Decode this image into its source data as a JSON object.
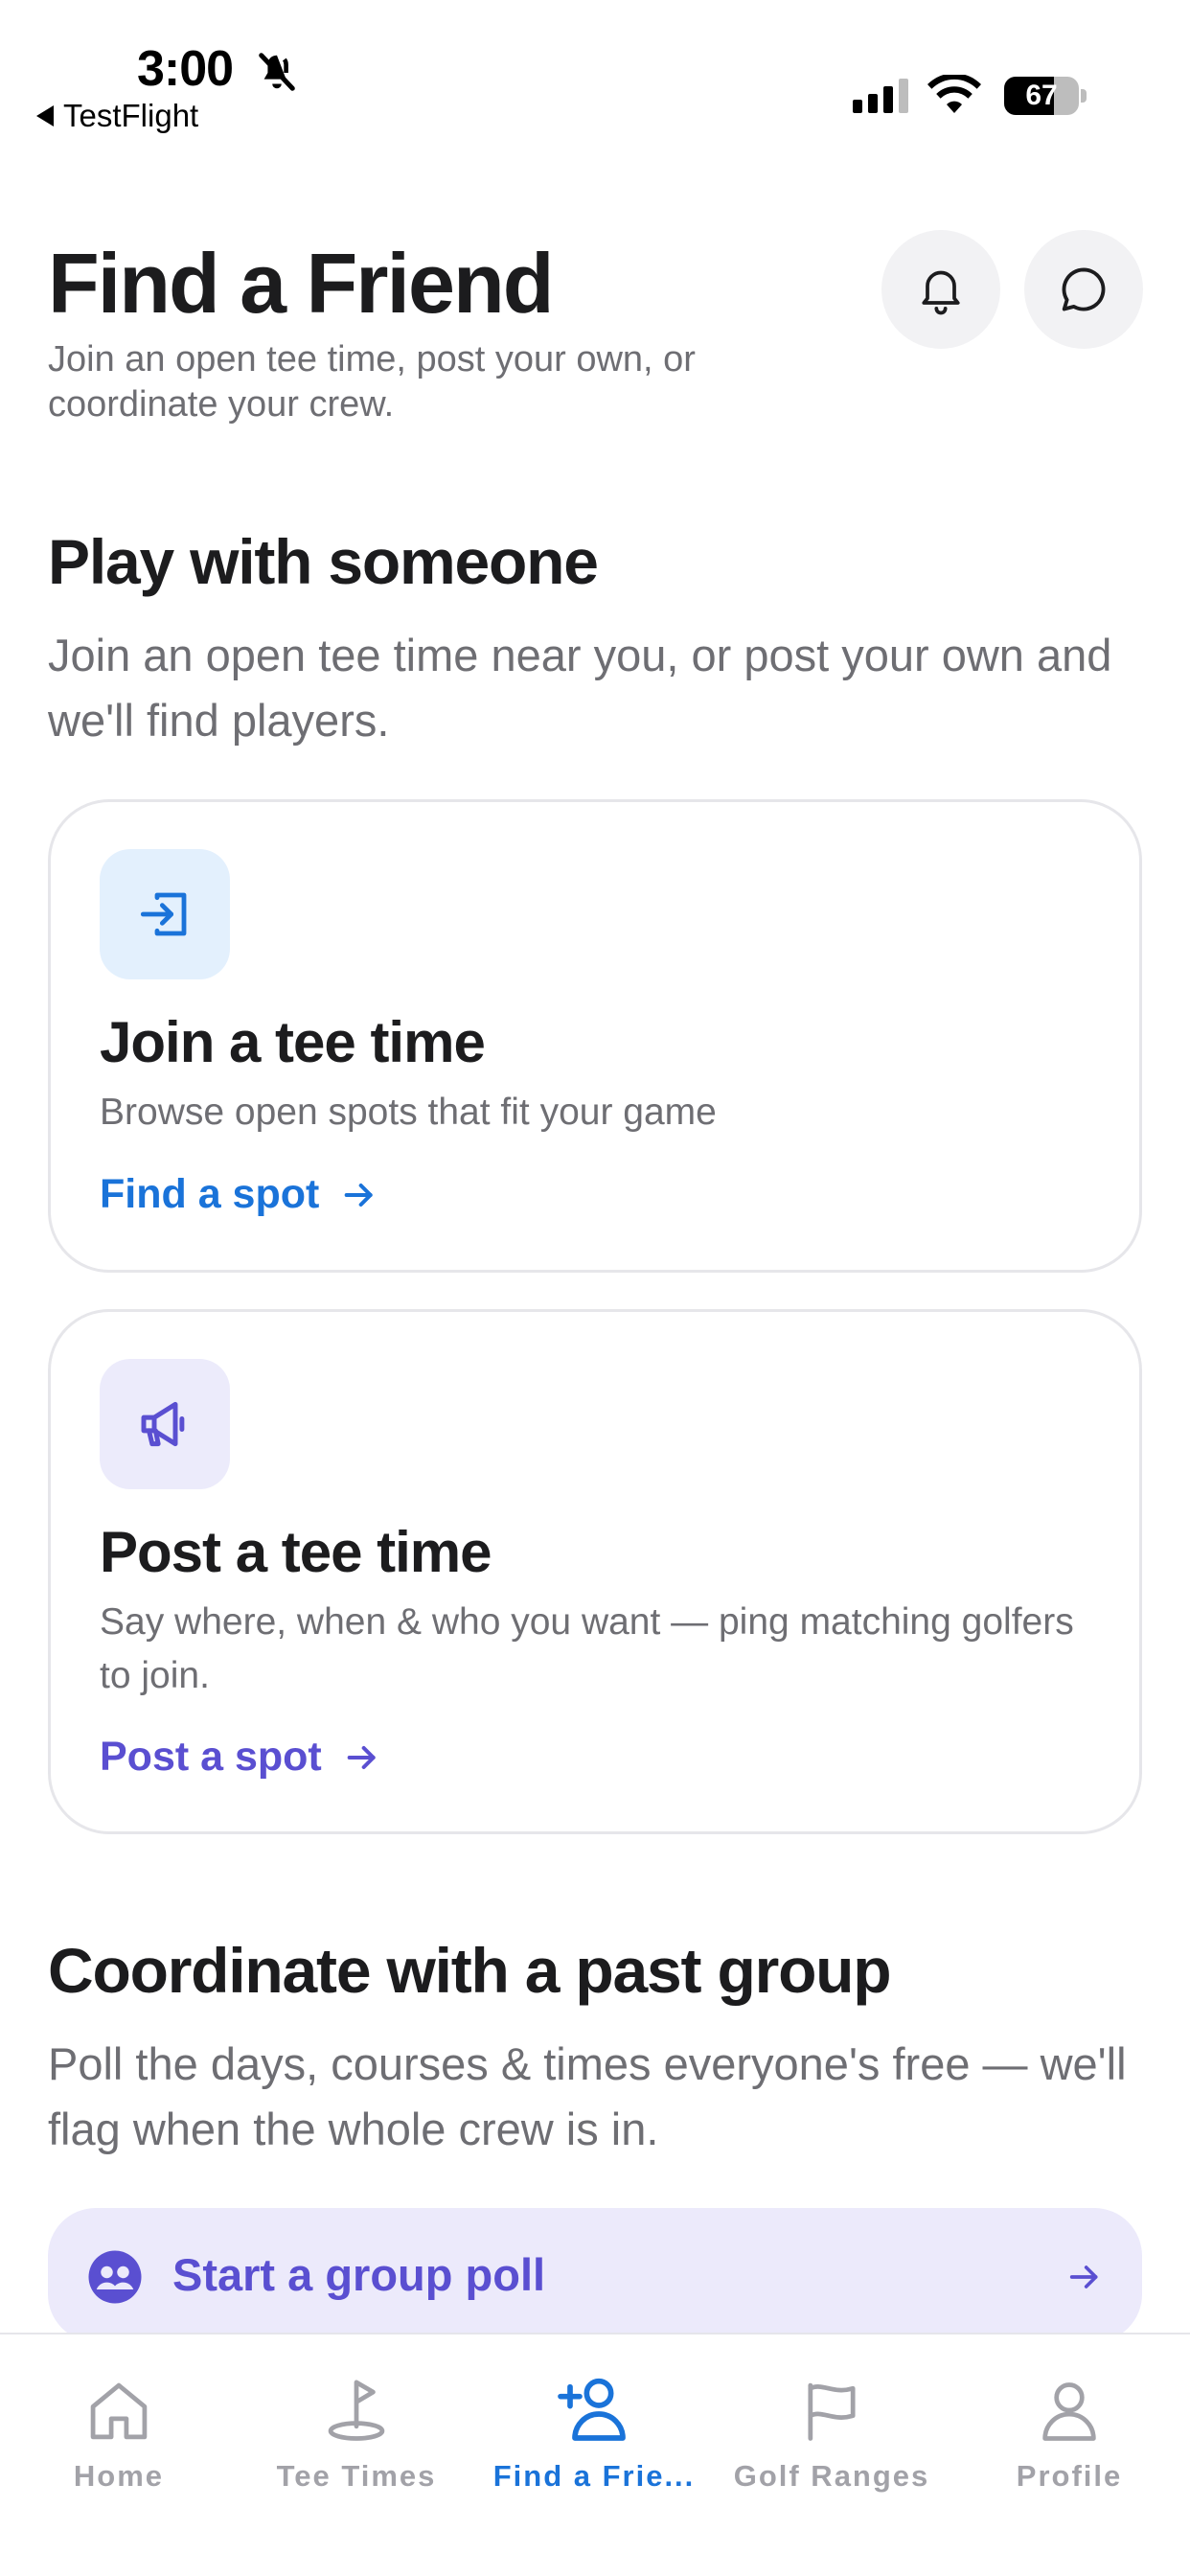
{
  "status_bar": {
    "time": "3:00",
    "back_app": "TestFlight",
    "battery": "67",
    "battery_level": 0.67
  },
  "header": {
    "title": "Find a Friend",
    "subtitle": "Join an open tee time, post your own, or coordinate your crew.",
    "notifications_icon": "bell-icon",
    "messages_icon": "chat-bubble-icon"
  },
  "play_section": {
    "title": "Play with someone",
    "description": "Join an open tee time near you, or post your own and we'll find players."
  },
  "cards": {
    "join": {
      "icon": "enter-icon",
      "title": "Join a tee time",
      "description": "Browse open spots that fit your game",
      "link": "Find a spot",
      "accent": "#1a73d9",
      "icon_bg": "#e3f0fd"
    },
    "post": {
      "icon": "megaphone-icon",
      "title": "Post a tee time",
      "description": "Say where, when & who you want — ping matching golfers to join.",
      "link": "Post a spot",
      "accent": "#5a4fd1",
      "icon_bg": "#ecebfb"
    }
  },
  "group_section": {
    "title": "Coordinate with a past group",
    "description": "Poll the days, courses & times everyone's free — we'll flag when the whole crew is in.",
    "button_label": "Start a group poll",
    "button_icon": "group-icon"
  },
  "tab_bar": {
    "tabs": [
      {
        "label": "Home",
        "icon": "home-icon",
        "active": false
      },
      {
        "label": "Tee Times",
        "icon": "golf-flag-icon",
        "active": false
      },
      {
        "label": "Find a Frie...",
        "icon": "add-friend-icon",
        "active": true
      },
      {
        "label": "Golf Ranges",
        "icon": "flag-icon",
        "active": false
      },
      {
        "label": "Profile",
        "icon": "person-icon",
        "active": false
      }
    ],
    "active_color": "#1a73d9",
    "inactive_color": "#a2a2a8"
  }
}
